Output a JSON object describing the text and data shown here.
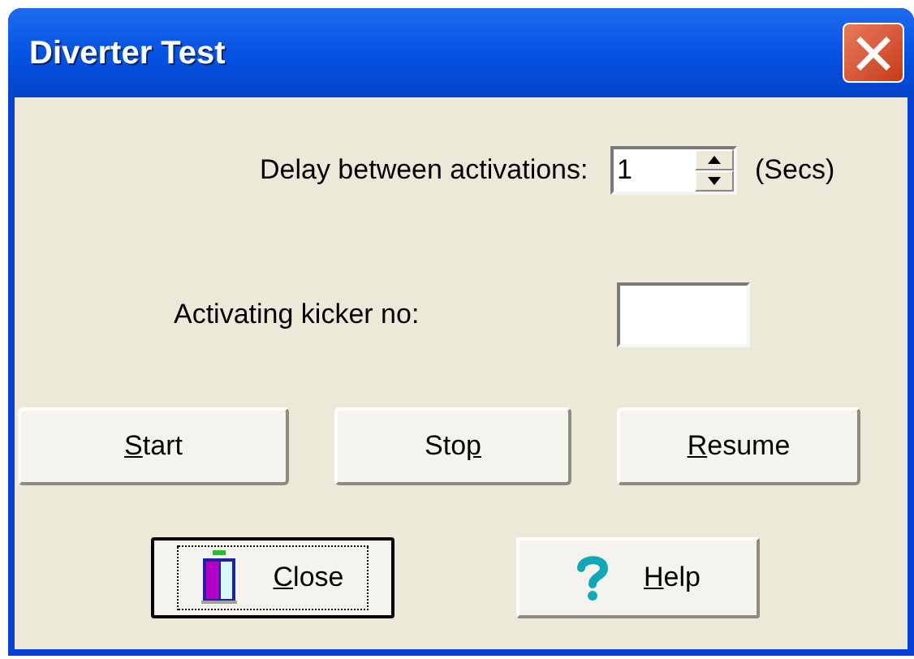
{
  "window": {
    "title": "Diverter Test"
  },
  "delay": {
    "label": "Delay between activations:",
    "value": "1",
    "unit": "(Secs)"
  },
  "kicker": {
    "label": "Activating kicker no:"
  },
  "action_buttons": [
    {
      "label": "Start",
      "mnemonic_last": false
    },
    {
      "label": "Stop",
      "mnemonic_last": true
    },
    {
      "label": "Resume",
      "mnemonic_last": false
    }
  ],
  "bottom_buttons": [
    {
      "label": "Close",
      "kind": "close",
      "mnemonic_last": false,
      "focused": true
    },
    {
      "label": "Help",
      "kind": "help",
      "mnemonic_last": false,
      "focused": false
    }
  ]
}
